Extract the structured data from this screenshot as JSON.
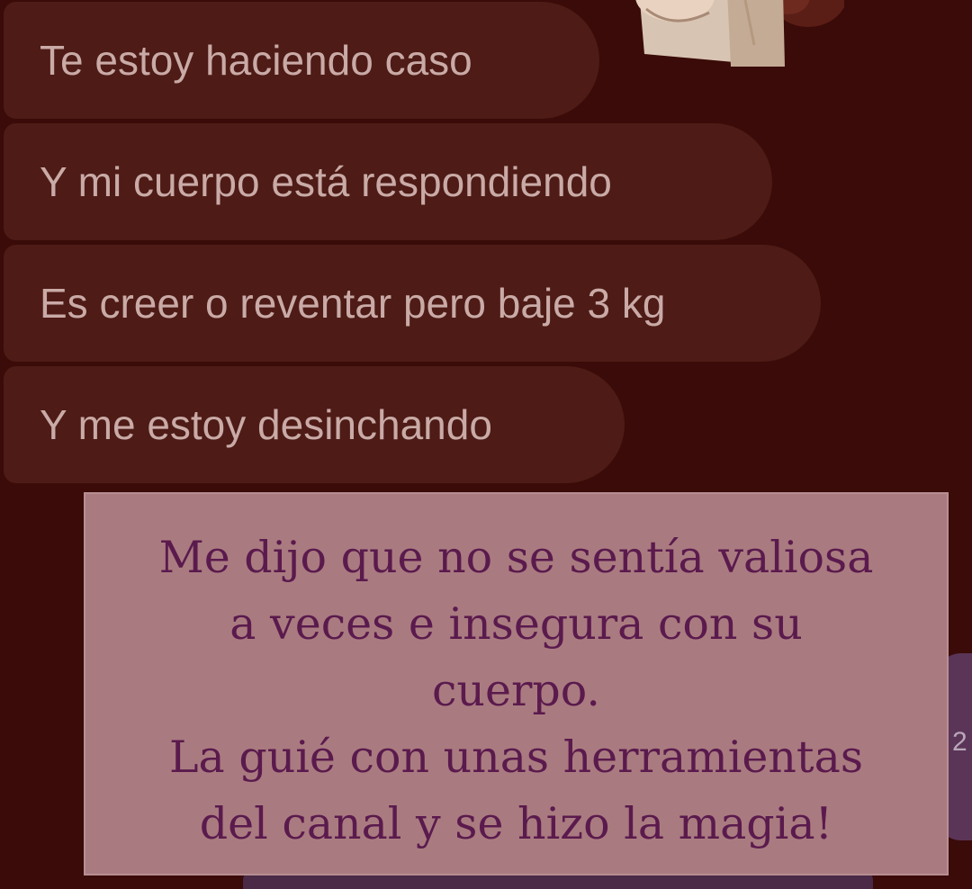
{
  "conversation": {
    "received_messages": [
      {
        "text": "Te estoy haciendo caso"
      },
      {
        "text": "Y mi cuerpo está respondiendo"
      },
      {
        "text": "Es creer o reventar pero baje 3 kg"
      },
      {
        "text": "Y me estoy desinchando"
      }
    ],
    "sent_partial_text": "2"
  },
  "overlay_caption": {
    "lines": [
      "Me dijo que no se sentía valiosa",
      "a veces e insegura con su",
      "cuerpo.",
      "La guié con unas herramientas",
      "del canal y se hizo la magia!"
    ]
  },
  "colors": {
    "background": "#3a0b08",
    "received_bubble": "#4e1b16",
    "received_text": "#c9aaa6",
    "caption_background": "#a97b80",
    "caption_text": "#5b1a4d",
    "sent_bubble": "#5a3558"
  }
}
